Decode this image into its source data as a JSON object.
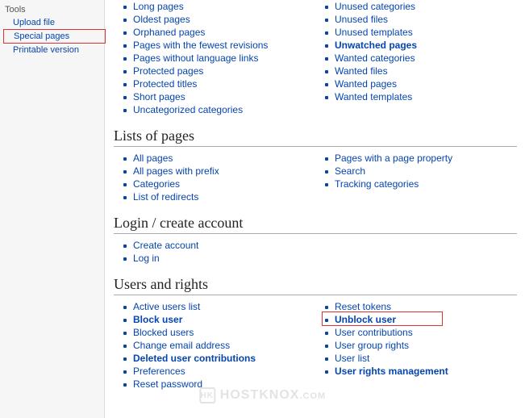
{
  "sidebar": {
    "heading": "Tools",
    "items": [
      {
        "label": "Upload file"
      },
      {
        "label": "Special pages"
      },
      {
        "label": "Printable version"
      }
    ]
  },
  "sections": {
    "maintenance": {
      "left": [
        "Long pages",
        "Oldest pages",
        "Orphaned pages",
        "Pages with the fewest revisions",
        "Pages without language links",
        "Protected pages",
        "Protected titles",
        "Short pages",
        "Uncategorized categories"
      ],
      "right": [
        "Unused categories",
        "Unused files",
        "Unused templates",
        "Unwatched pages",
        "Wanted categories",
        "Wanted files",
        "Wanted pages",
        "Wanted templates"
      ]
    },
    "lists": {
      "title": "Lists of pages",
      "left": [
        "All pages",
        "All pages with prefix",
        "Categories",
        "List of redirects"
      ],
      "right": [
        "Pages with a page property",
        "Search",
        "Tracking categories"
      ]
    },
    "login": {
      "title": "Login / create account",
      "left": [
        "Create account",
        "Log in"
      ]
    },
    "users": {
      "title": "Users and rights",
      "left": [
        "Active users list",
        "Block user",
        "Blocked users",
        "Change email address",
        "Deleted user contributions",
        "Preferences",
        "Reset password"
      ],
      "right": [
        "Reset tokens",
        "Unblock user",
        "User contributions",
        "User group rights",
        "User list",
        "User rights management"
      ]
    }
  },
  "bold_items": [
    "Unwatched pages",
    "Block user",
    "Deleted user contributions",
    "Unblock user",
    "User rights management"
  ],
  "watermark": {
    "text": "HOSTKNOX",
    "suffix": ".COM",
    "icon": "HK"
  }
}
